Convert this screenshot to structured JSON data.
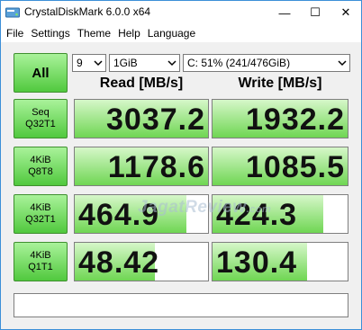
{
  "window": {
    "title": "CrystalDiskMark 6.0.0 x64",
    "minimize_label": "—",
    "maximize_label": "☐",
    "close_label": "✕"
  },
  "menu": [
    "File",
    "Settings",
    "Theme",
    "Help",
    "Language"
  ],
  "controls": {
    "all_label": "All",
    "count": "9",
    "size": "1GiB",
    "drive": "C: 51% (241/476GiB)"
  },
  "columns": {
    "read": "Read [MB/s]",
    "write": "Write [MB/s]"
  },
  "rows": [
    {
      "line1": "Seq",
      "line2": "Q32T1",
      "read": "3037.2",
      "write": "1932.2",
      "read_fill": 1.0,
      "write_fill": 1.0
    },
    {
      "line1": "4KiB",
      "line2": "Q8T8",
      "read": "1178.6",
      "write": "1085.5",
      "read_fill": 1.0,
      "write_fill": 1.0
    },
    {
      "line1": "4KiB",
      "line2": "Q32T1",
      "read": "464.9",
      "write": "424.3",
      "read_fill": 0.84,
      "write_fill": 0.82
    },
    {
      "line1": "4KiB",
      "line2": "Q1T1",
      "read": "48.42",
      "write": "130.4",
      "read_fill": 0.6,
      "write_fill": 0.7
    }
  ],
  "watermark": {
    "main": "JagatReview",
    "suffix": ".com"
  },
  "status": "",
  "colors": {
    "accent_green_top": "#a9f29a",
    "accent_green_bottom": "#51c93e",
    "window_border": "#3c8fd8"
  }
}
